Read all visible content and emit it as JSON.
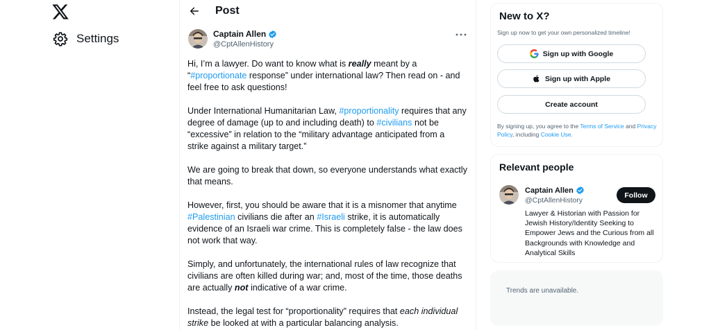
{
  "nav": {
    "logo_icon": "x-logo-icon",
    "settings_label": "Settings"
  },
  "header": {
    "title": "Post"
  },
  "post": {
    "author_name": "Captain Allen",
    "author_handle": "@CptAllenHistory",
    "paragraphs": [
      [
        {
          "t": "Hi, I’m a lawyer. Do want to know what is "
        },
        {
          "t": "really",
          "s": "bi"
        },
        {
          "t": " meant by a “"
        },
        {
          "t": "#proportionate",
          "s": "tag"
        },
        {
          "t": " response” under international law? Then read on - and feel free to ask questions!"
        }
      ],
      [
        {
          "t": "Under International Humanitarian Law, "
        },
        {
          "t": "#proportionality",
          "s": "tag"
        },
        {
          "t": " requires that any degree of damage (up to and including death) to "
        },
        {
          "t": "#civilians",
          "s": "tag"
        },
        {
          "t": " not be “excessive” in relation to the “military advantage anticipated from a strike against a military target.”"
        }
      ],
      [
        {
          "t": "We are going to break that down, so everyone understands what exactly that means."
        }
      ],
      [
        {
          "t": "However, first, you should be aware that it is a misnomer that anytime "
        },
        {
          "t": "#Palestinian",
          "s": "tag"
        },
        {
          "t": " civilians die after an "
        },
        {
          "t": "#Israeli",
          "s": "tag"
        },
        {
          "t": " strike, it is automatically evidence of an Israeli war crime. This is completely false - the law does not work that way."
        }
      ],
      [
        {
          "t": "Simply, and unfortunately, the international rules of law recognize that civilians are often killed during war; and, most of the time, those deaths are actually "
        },
        {
          "t": "not",
          "s": "bi"
        },
        {
          "t": " indicative of a war crime."
        }
      ],
      [
        {
          "t": "Instead, the legal test for “proportionality” requires that "
        },
        {
          "t": "each individual strike",
          "s": "i"
        },
        {
          "t": " be looked at with a particular balancing analysis."
        }
      ]
    ]
  },
  "signup": {
    "title": "New to X?",
    "subtitle": "Sign up now to get your own personalized timeline!",
    "google_label": "Sign up with Google",
    "apple_label": "Sign up with Apple",
    "create_label": "Create account",
    "legal_prefix": "By signing up, you agree to the ",
    "terms_link": "Terms of Service",
    "legal_and": " and ",
    "privacy_link": "Privacy Policy",
    "legal_including": ", including ",
    "cookie_link": "Cookie Use.",
    "colors": {
      "google_blue": "#4285F4",
      "google_red": "#EA4335",
      "google_yellow": "#FBBC05",
      "google_green": "#34A853"
    }
  },
  "relevant": {
    "title": "Relevant people",
    "name": "Captain Allen",
    "handle": "@CptAllenHistory",
    "follow_label": "Follow",
    "bio": "Lawyer & Historian with Passion for Jewish History/Identity Seeking to Empower Jews and the Curious from all Backgrounds with Knowledge and Analytical Skills"
  },
  "trends": {
    "text": "Trends are unavailable."
  },
  "colors": {
    "accent": "#1d9bf0",
    "text_primary": "#0f1419",
    "text_secondary": "#536471",
    "border": "#eff3f4"
  }
}
